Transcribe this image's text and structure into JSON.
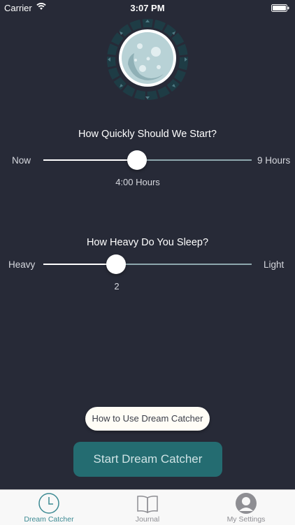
{
  "status_bar": {
    "carrier": "Carrier",
    "time": "3:07 PM",
    "icons": [
      "wifi-icon",
      "battery-icon"
    ]
  },
  "header": {
    "icon": "moon-icon"
  },
  "start_delay": {
    "title": "How Quickly Should We Start?",
    "min_label": "Now",
    "max_label": "9 Hours",
    "value_label": "4:00 Hours",
    "value_fraction": 0.45
  },
  "sleep_depth": {
    "title": "How Heavy Do You Sleep?",
    "min_label": "Heavy",
    "max_label": "Light",
    "value_label": "2",
    "value_fraction": 0.35
  },
  "buttons": {
    "how_to": "How to Use Dream Catcher",
    "start": "Start Dream Catcher"
  },
  "tab_bar": {
    "tabs": [
      {
        "label": "Dream Catcher",
        "icon": "clock-icon",
        "active": true
      },
      {
        "label": "Journal",
        "icon": "book-icon",
        "active": false
      },
      {
        "label": "My Settings",
        "icon": "profile-icon",
        "active": false
      }
    ]
  },
  "colors": {
    "background": "#272a37",
    "accent": "#246c71",
    "active_tab": "#3c8a93",
    "inactive_tab": "#8e8e93",
    "slider_track": "#8ea7ad"
  }
}
